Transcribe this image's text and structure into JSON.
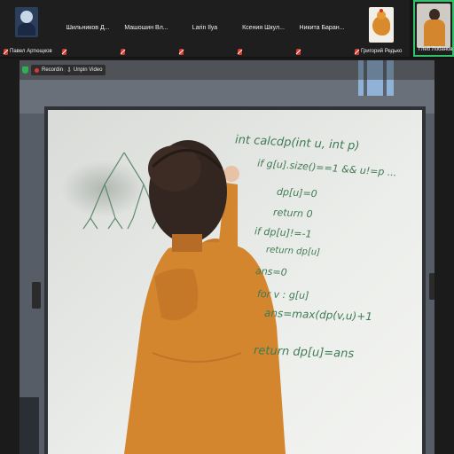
{
  "participants": [
    {
      "name": "Павел Артющков",
      "muted": true,
      "has_avatar": true,
      "avatar_kind": "profile-photo"
    },
    {
      "name": "Шильников Д...",
      "muted": true
    },
    {
      "name": "Машошин Вл...",
      "muted": true
    },
    {
      "name": "Larin Ilya",
      "muted": true
    },
    {
      "name": "Ксения Шкул...",
      "muted": true
    },
    {
      "name": "Никита Баран...",
      "muted": true
    },
    {
      "name": "Григорий Редько",
      "muted": true,
      "has_avatar": true,
      "avatar_kind": "chicken-photo"
    },
    {
      "name": "Глеб Лобанов",
      "muted": false,
      "active_speaker": true,
      "has_avatar": true,
      "avatar_kind": "camera-video"
    }
  ],
  "video_toolbar": {
    "recording_label": "Recording",
    "unpin_label": "Unpin Video"
  },
  "whiteboard": {
    "code_lines": [
      "int calcdp(int u, int p)",
      "if g[u].size()==1 && u!=p ...",
      "dp[u]=0",
      "return 0",
      "if dp[u]!=-1",
      "return dp[u]",
      "ans=0",
      "for v : g[u]",
      "ans=max(dp(v,u)+1",
      "return dp[u]=ans"
    ]
  },
  "colors": {
    "active_border": "#35c06a",
    "muted_mic": "#e0392b",
    "recording_dot": "#e0392b",
    "marker_ink": "#3f7a52",
    "hoodie": "#d4862e"
  }
}
